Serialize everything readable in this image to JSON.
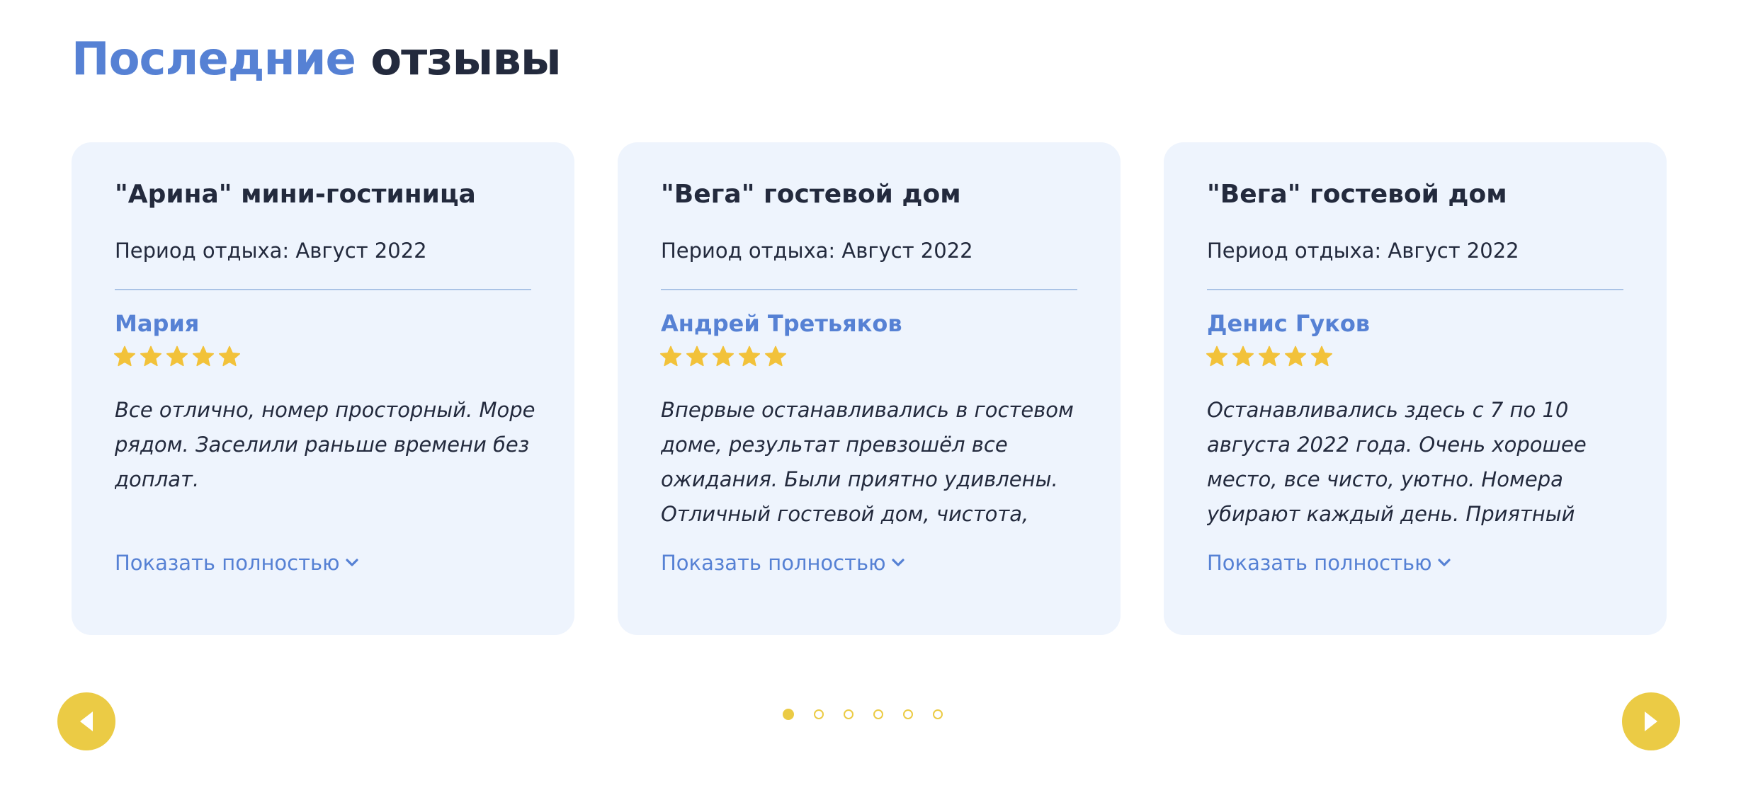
{
  "section": {
    "title_accent": "Последние",
    "title_rest": " отзывы"
  },
  "reviews": [
    {
      "hotel": "\"Арина\" мини-гостиница",
      "period": "Период отдыха: Август 2022",
      "author": "Мария",
      "rating": 5,
      "text": "Все отлично, номер просторный. Море рядом. Заселили раньше времени без доплат.",
      "show_more": "Показать полностью"
    },
    {
      "hotel": "\"Вега\" гостевой дом",
      "period": "Период отдыха: Август 2022",
      "author": "Андрей Третьяков",
      "rating": 5,
      "text": "Впервые останавливались в гостевом доме, результат превзошёл все ожидания. Были приятно удивлены. Отличный гостевой дом, чистота,",
      "show_more": "Показать полностью"
    },
    {
      "hotel": "\"Вега\" гостевой дом",
      "period": "Период отдыха: Август 2022",
      "author": "Денис Гуков",
      "rating": 5,
      "text": "Останавливались здесь с 7 по 10 августа 2022 года. Очень хорошее место, все чисто, уютно. Номера убирают каждый день. Приятный",
      "show_more": "Показать полностью"
    }
  ],
  "pagination": {
    "total_pages": 6,
    "current_page": 1
  },
  "colors": {
    "accent": "#5681d4",
    "dark_text": "#232a3d",
    "card_bg": "#eef4fd",
    "yellow": "#ebcb45",
    "star": "#f2c23a"
  },
  "icons": {
    "prev": "triangle-left-icon",
    "next": "triangle-right-icon",
    "star": "star-icon",
    "chevron": "chevron-down-icon"
  }
}
